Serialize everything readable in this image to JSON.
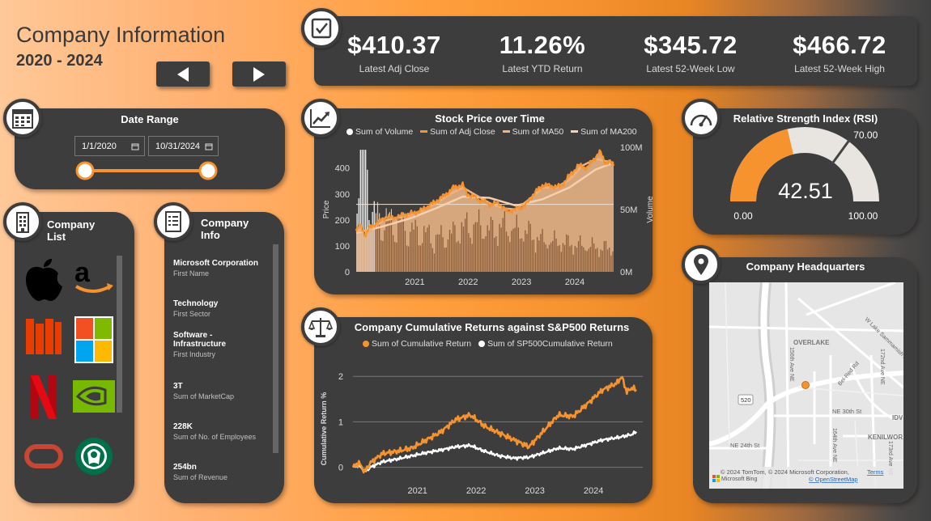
{
  "header": {
    "title": "Company Information",
    "subtitle": "2020 - 2024"
  },
  "kpis": [
    {
      "value": "$410.37",
      "label": "Latest Adj Close"
    },
    {
      "value": "11.26%",
      "label": "Latest YTD Return"
    },
    {
      "value": "$345.72",
      "label": "Latest 52-Week Low"
    },
    {
      "value": "$466.72",
      "label": "Latest 52-Week High"
    }
  ],
  "date_range": {
    "title": "Date Range",
    "start": "1/1/2020",
    "end": "10/31/2024"
  },
  "company_list": {
    "title": "Company\nList",
    "companies": [
      "apple-logo",
      "amazon-logo",
      "microsoft-logo",
      "netflix-logo",
      "nvidia-logo",
      "oracle-logo",
      "starbucks-logo"
    ],
    "note": "Office/Microsoft style logo at row 2 col 1 is orange"
  },
  "company_info": {
    "title": "Company\nInfo",
    "items": [
      {
        "value": "Microsoft Corporation",
        "label": "First Name"
      },
      {
        "value": "Technology",
        "label": "First Sector"
      },
      {
        "value": "Software -\nInfrastructure",
        "label": "First Industry"
      },
      {
        "value": "3T",
        "label": "Sum of MarketCap"
      },
      {
        "value": "228K",
        "label": "Sum of No. of Employees"
      },
      {
        "value": "254bn",
        "label": "Sum of Revenue"
      }
    ]
  },
  "stock_chart": {
    "title": "Stock Price over Time",
    "legend": [
      "Sum of Volume",
      "Sum of Adj Close",
      "Sum of MA50",
      "Sum of MA200"
    ]
  },
  "rsi": {
    "title": "Relative Strength Index (RSI)",
    "value": "42.51",
    "min_label": "0.00",
    "max_label": "100.00",
    "target_label": "70.00"
  },
  "returns_chart": {
    "title": "Company Cumulative Returns against S&P500 Returns",
    "legend": [
      "Sum of Cumulative Return",
      "Sum of SP500Cumulative Return"
    ]
  },
  "headquarters": {
    "title": "Company Headquarters",
    "labels": {
      "overlake": "OVERLAKE",
      "ne24": "NE 24th St",
      "ne30": "NE 30th St",
      "kenilworth": "KENILWOR",
      "idv": "IDV",
      "hwy520": "520",
      "ave156": "156th Ave NE",
      "ave172": "172nd Ave NE",
      "ave173": "173rd Ave NE",
      "ave164": "164th Ave NE",
      "belred": "Bel-Red Rd",
      "wlake": "W Lake Sammamish Pkwy"
    },
    "copyright": "© 2024 TomTom, © 2024 Microsoft Corporation,",
    "terms": "Terms",
    "osm": "© OpenStreetMap",
    "bing": "Microsoft Bing"
  },
  "chart_data": [
    {
      "type": "line",
      "title": "Stock Price over Time",
      "xlabel": "",
      "ylabel": "Price",
      "y2label": "Volume",
      "x_ticks": [
        "2021",
        "2022",
        "2023",
        "2024"
      ],
      "y_ticks": [
        0,
        100,
        200,
        300,
        400
      ],
      "y2_ticks": [
        "0M",
        "50M",
        "100M"
      ],
      "ylim": [
        0,
        480
      ],
      "y2lim": [
        0,
        100
      ],
      "x_range": [
        2020.0,
        2024.83
      ],
      "series": [
        {
          "name": "Sum of Adj Close",
          "color": "#f7932f",
          "x": [
            2020.0,
            2020.08,
            2020.17,
            2020.25,
            2020.33,
            2020.42,
            2020.5,
            2020.58,
            2020.67,
            2020.75,
            2020.83,
            2020.92,
            2021.0,
            2021.17,
            2021.33,
            2021.5,
            2021.67,
            2021.83,
            2022.0,
            2022.08,
            2022.17,
            2022.33,
            2022.5,
            2022.67,
            2022.83,
            2023.0,
            2023.17,
            2023.33,
            2023.5,
            2023.67,
            2023.83,
            2024.0,
            2024.17,
            2024.33,
            2024.5,
            2024.58,
            2024.67,
            2024.75,
            2024.83
          ],
          "values": [
            158,
            180,
            140,
            170,
            182,
            190,
            205,
            213,
            207,
            212,
            214,
            222,
            223,
            232,
            250,
            272,
            296,
            325,
            335,
            300,
            292,
            275,
            260,
            265,
            232,
            240,
            255,
            300,
            335,
            330,
            328,
            370,
            410,
            400,
            445,
            462,
            420,
            425,
            410
          ]
        },
        {
          "name": "Sum of MA50",
          "color": "#f4b27a",
          "x": [
            2020.0,
            2020.25,
            2020.5,
            2020.75,
            2021.0,
            2021.25,
            2021.5,
            2021.75,
            2022.0,
            2022.25,
            2022.5,
            2022.75,
            2023.0,
            2023.25,
            2023.5,
            2023.75,
            2024.0,
            2024.25,
            2024.5,
            2024.83
          ],
          "values": [
            155,
            160,
            195,
            208,
            218,
            238,
            265,
            298,
            325,
            295,
            265,
            245,
            240,
            280,
            325,
            325,
            355,
            410,
            435,
            420
          ]
        },
        {
          "name": "Sum of MA200",
          "color": "#f8d0ae",
          "x": [
            2020.0,
            2020.5,
            2021.0,
            2021.5,
            2022.0,
            2022.5,
            2023.0,
            2023.5,
            2024.0,
            2024.5,
            2024.83
          ],
          "values": [
            150,
            175,
            205,
            245,
            290,
            285,
            255,
            280,
            325,
            395,
            420
          ]
        },
        {
          "name": "Sum of Volume",
          "axis": "y2",
          "color": "#ffffff",
          "x": [
            2020.1,
            2020.2,
            2020.3,
            2020.5,
            2020.75,
            2021.0,
            2021.25,
            2021.5,
            2021.75,
            2022.0,
            2022.25,
            2022.5,
            2022.75,
            2023.0,
            2023.25,
            2023.5,
            2023.75,
            2024.0,
            2024.25,
            2024.5,
            2024.83
          ],
          "values": [
            85,
            95,
            45,
            40,
            38,
            32,
            30,
            26,
            28,
            34,
            36,
            32,
            35,
            32,
            30,
            24,
            23,
            22,
            20,
            19,
            18
          ]
        }
      ]
    },
    {
      "type": "line",
      "title": "Company Cumulative Returns against S&P500 Returns",
      "xlabel": "",
      "ylabel": "Cumulative Return %",
      "x_ticks": [
        "2021",
        "2022",
        "2023",
        "2024"
      ],
      "y_ticks": [
        0,
        1,
        2
      ],
      "ylim": [
        -0.15,
        2.2
      ],
      "x_range": [
        2020.0,
        2024.83
      ],
      "series": [
        {
          "name": "Sum of Cumulative Return",
          "color": "#f7932f",
          "x": [
            2020.0,
            2020.1,
            2020.2,
            2020.3,
            2020.5,
            2020.75,
            2021.0,
            2021.25,
            2021.5,
            2021.75,
            2022.0,
            2022.25,
            2022.5,
            2022.75,
            2023.0,
            2023.25,
            2023.5,
            2023.75,
            2024.0,
            2024.25,
            2024.5,
            2024.58,
            2024.67,
            2024.75,
            2024.83
          ],
          "values": [
            0,
            0.1,
            -0.1,
            0.1,
            0.3,
            0.35,
            0.42,
            0.6,
            0.78,
            1.05,
            1.15,
            0.9,
            0.75,
            0.6,
            0.45,
            0.8,
            1.15,
            1.12,
            1.4,
            1.7,
            1.85,
            2.0,
            1.65,
            1.75,
            1.7
          ]
        },
        {
          "name": "Sum of SP500Cumulative Return",
          "color": "#ffffff",
          "x": [
            2020.0,
            2020.1,
            2020.2,
            2020.3,
            2020.5,
            2020.75,
            2021.0,
            2021.25,
            2021.5,
            2021.75,
            2022.0,
            2022.25,
            2022.5,
            2022.75,
            2023.0,
            2023.25,
            2023.5,
            2023.75,
            2024.0,
            2024.25,
            2024.5,
            2024.75,
            2024.83
          ],
          "values": [
            0,
            0.05,
            -0.1,
            0.0,
            0.12,
            0.18,
            0.25,
            0.32,
            0.38,
            0.45,
            0.48,
            0.35,
            0.25,
            0.2,
            0.22,
            0.32,
            0.42,
            0.4,
            0.5,
            0.6,
            0.65,
            0.72,
            0.78
          ]
        }
      ]
    }
  ]
}
